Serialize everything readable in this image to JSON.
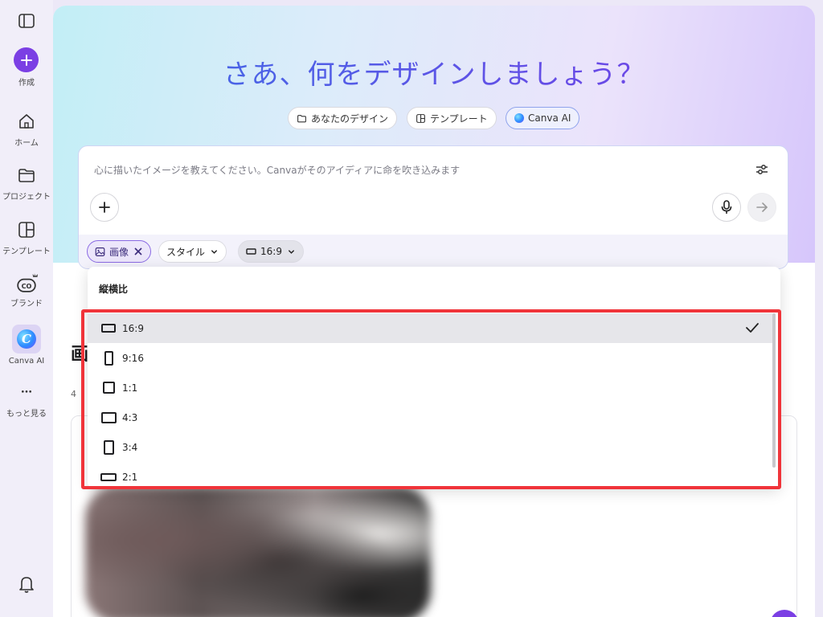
{
  "sidebar": {
    "create_label": "作成",
    "items": [
      {
        "label": "ホーム",
        "icon": "home-icon"
      },
      {
        "label": "プロジェクト",
        "icon": "folder-icon"
      },
      {
        "label": "テンプレート",
        "icon": "template-icon"
      },
      {
        "label": "ブランド",
        "icon": "brand-icon"
      },
      {
        "label": "Canva AI",
        "icon": "canva-ai-icon"
      },
      {
        "label": "もっと見る",
        "icon": "more-icon"
      }
    ],
    "active_item": "Canva AI",
    "ai_logo_letter": "C"
  },
  "hero": {
    "title": "さあ、何をデザインしましょう？",
    "tabs": [
      {
        "label": "あなたのデザイン",
        "icon": "folder-icon"
      },
      {
        "label": "テンプレート",
        "icon": "template-icon"
      },
      {
        "label": "Canva AI",
        "icon": "canva-ai-icon",
        "selected": true
      }
    ]
  },
  "prompt": {
    "placeholder": "心に描いたイメージを教えてください。Canvaがそのアイディアに命を吹き込みます",
    "chips": {
      "image": "画像",
      "style": "スタイル",
      "ratio": "16:9"
    }
  },
  "content": {
    "section_title_partial": "画",
    "section_sub_partial": "4"
  },
  "dropdown": {
    "header": "縦横比",
    "options": [
      {
        "label": "16:9",
        "selected": true
      },
      {
        "label": "9:16",
        "selected": false
      },
      {
        "label": "1:1",
        "selected": false
      },
      {
        "label": "4:3",
        "selected": false
      },
      {
        "label": "3:4",
        "selected": false
      },
      {
        "label": "2:1",
        "selected": false
      }
    ]
  },
  "colors": {
    "accent": "#7b3fe4",
    "highlight": "#f0343a",
    "title_gradient_start": "#3b6fe6",
    "title_gradient_end": "#7a3ce6"
  }
}
